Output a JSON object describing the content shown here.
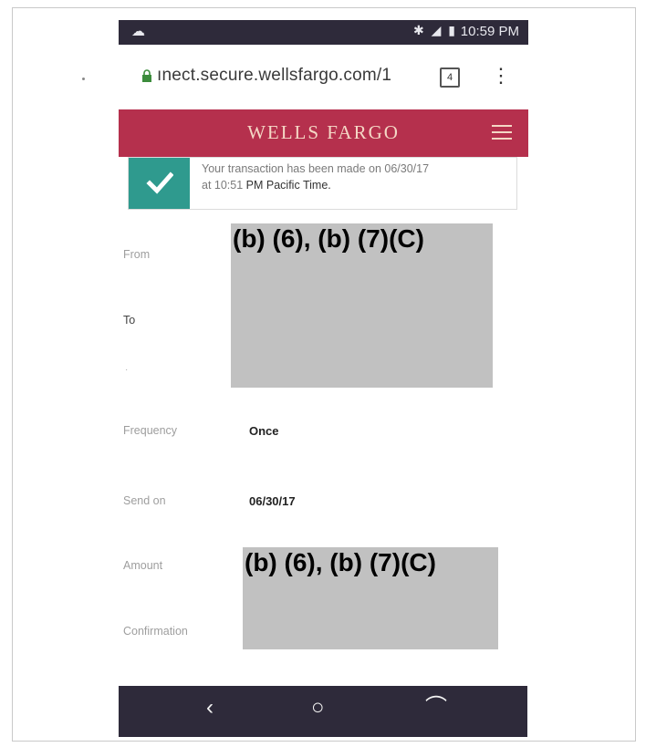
{
  "status_bar": {
    "time": "10:59 PM",
    "signal_icons": "✱ ◢ ▮"
  },
  "browser": {
    "url": "ınect.secure.wellsfargo.com/1",
    "tab_count": "4"
  },
  "header": {
    "brand": "WELLS FARGO",
    "brand_color": "#b5304d"
  },
  "notice": {
    "text_line1": "Your transaction has been made on 06/30/17",
    "text_line2_prefix": "at 10:51",
    "text_line2_suffix": "PM Pacific Time.",
    "accent_color": "#2f9a8e"
  },
  "details": {
    "from_label": "From",
    "to_label": "To",
    "frequency_label": "Frequency",
    "frequency_value": "Once",
    "send_on_label": "Send on",
    "send_on_value": "06/30/17",
    "amount_label": "Amount",
    "confirmation_label": "Confirmation"
  },
  "redactions": {
    "top_label": "(b) (6), (b) (7)(C)",
    "bottom_label": "(b) (6), (b) (7)(C)"
  },
  "nav": {
    "back_icon": "back-icon",
    "home_icon": "home-icon",
    "recents_icon": "recents-icon"
  }
}
